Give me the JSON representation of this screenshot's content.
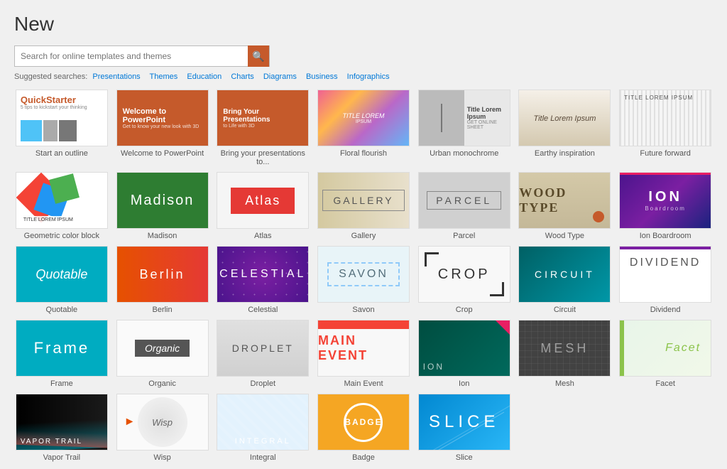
{
  "page": {
    "title": "New"
  },
  "search": {
    "placeholder": "Search for online templates and themes"
  },
  "suggested": {
    "label": "Suggested searches:",
    "links": [
      "Presentations",
      "Themes",
      "Education",
      "Charts",
      "Diagrams",
      "Business",
      "Infographics"
    ]
  },
  "templates": [
    {
      "id": "quickstarter",
      "label": "Start an outline",
      "type": "quickstarter"
    },
    {
      "id": "welcome",
      "label": "Welcome to PowerPoint",
      "type": "welcome"
    },
    {
      "id": "bring",
      "label": "Bring your presentations to...",
      "type": "bring"
    },
    {
      "id": "floral",
      "label": "Floral flourish",
      "type": "floral"
    },
    {
      "id": "urban",
      "label": "Urban monochrome",
      "type": "urban"
    },
    {
      "id": "earthy",
      "label": "Earthy inspiration",
      "type": "earthy"
    },
    {
      "id": "future",
      "label": "Future forward",
      "type": "future"
    },
    {
      "id": "geo",
      "label": "Geometric color block",
      "type": "geo"
    },
    {
      "id": "madison",
      "label": "Madison",
      "type": "madison"
    },
    {
      "id": "atlas",
      "label": "Atlas",
      "type": "atlas"
    },
    {
      "id": "gallery",
      "label": "Gallery",
      "type": "gallery"
    },
    {
      "id": "parcel",
      "label": "Parcel",
      "type": "parcel"
    },
    {
      "id": "woodtype",
      "label": "Wood Type",
      "type": "woodtype"
    },
    {
      "id": "ionboardroom",
      "label": "Ion Boardroom",
      "type": "ionboardroom"
    },
    {
      "id": "quotable",
      "label": "Quotable",
      "type": "quotable"
    },
    {
      "id": "berlin",
      "label": "Berlin",
      "type": "berlin"
    },
    {
      "id": "celestial",
      "label": "Celestial",
      "type": "celestial"
    },
    {
      "id": "savon",
      "label": "Savon",
      "type": "savon"
    },
    {
      "id": "crop",
      "label": "Crop",
      "type": "crop"
    },
    {
      "id": "circuit",
      "label": "Circuit",
      "type": "circuit"
    },
    {
      "id": "dividend",
      "label": "Dividend",
      "type": "dividend"
    },
    {
      "id": "frame",
      "label": "Frame",
      "type": "frame"
    },
    {
      "id": "organic",
      "label": "Organic",
      "type": "organic"
    },
    {
      "id": "droplet",
      "label": "Droplet",
      "type": "droplet"
    },
    {
      "id": "mainevent",
      "label": "Main Event",
      "type": "mainevent"
    },
    {
      "id": "ion2",
      "label": "Ion",
      "type": "ion2"
    },
    {
      "id": "mesh",
      "label": "Mesh",
      "type": "mesh"
    },
    {
      "id": "facet",
      "label": "Facet",
      "type": "facet"
    },
    {
      "id": "vapor",
      "label": "Vapor Trail",
      "type": "vapor"
    },
    {
      "id": "wisp",
      "label": "Wisp",
      "type": "wisp"
    },
    {
      "id": "integral",
      "label": "Integral",
      "type": "integral"
    },
    {
      "id": "badge",
      "label": "Badge",
      "type": "badge"
    },
    {
      "id": "slice",
      "label": "Slice",
      "type": "slice"
    }
  ],
  "template_texts": {
    "quickstarter": "QuickStarter",
    "welcome_title": "Welcome to PowerPoint",
    "welcome_sub": "Get to know your new look with 3D",
    "bring_title": "Bring Your Presentations",
    "bring_sub": "to Life with 3D",
    "floral_title": "TITLE LOREM",
    "floral_sub": "IPSUM",
    "urban_title": "Title Lorem Ipsum",
    "urban_sub": "GET ONLINE SHEET",
    "earthy_title": "Title Lorem Ipsum",
    "future_title": "TITLE LOREM IPSUM",
    "geo_sub": "TITLE LOREM IPSUM",
    "madison": "Madison",
    "atlas": "Atlas",
    "gallery": "GALLERY",
    "parcel": "PARCEL",
    "woodtype": "WOOD TYPE",
    "ion_boardroom": "ION",
    "quotable": "Quotable",
    "berlin": "Berlin",
    "celestial": "CELESTIAL",
    "savon": "SAVON",
    "crop": "CROP",
    "circuit": "CIRCUIT",
    "dividend": "DIVIDEND",
    "frame": "Frame",
    "organic": "Organic",
    "droplet": "DROPLET",
    "mainevent": "MAIN EVENT",
    "ion2": "ION",
    "mesh": "MESH",
    "facet": "Facet",
    "vapor": "VAPOR TRAIL",
    "wisp": "Wisp",
    "integral": "INTEGRAL",
    "badge": "BADGE",
    "slice": "SLICE"
  }
}
